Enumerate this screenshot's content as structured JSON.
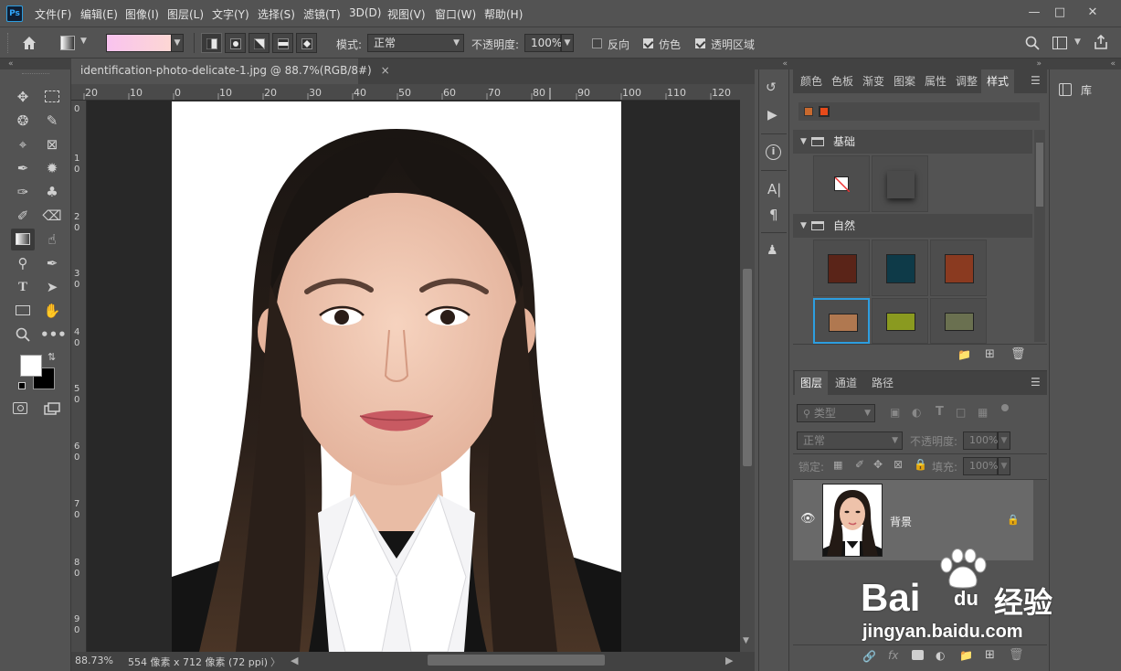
{
  "app": {
    "logo": "Ps"
  },
  "menu": [
    "文件(F)",
    "编辑(E)",
    "图像(I)",
    "图层(L)",
    "文字(Y)",
    "选择(S)",
    "滤镜(T)",
    "3D(D)",
    "视图(V)",
    "窗口(W)",
    "帮助(H)"
  ],
  "options": {
    "mode_label": "模式:",
    "mode_value": "正常",
    "opacity_label": "不透明度:",
    "opacity_value": "100%",
    "reverse_label": "反向",
    "dither_label": "仿色",
    "transparency_label": "透明区域",
    "reverse_checked": false,
    "dither_checked": true,
    "transparency_checked": true
  },
  "document": {
    "tab_title": "identification-photo-delicate-1.jpg @ 88.7%(RGB/8#)",
    "tab_close": "×",
    "ruler_h": [
      "20",
      "10",
      "0",
      "10",
      "20",
      "30",
      "40",
      "50",
      "60",
      "70",
      "80",
      "90",
      "100",
      "110",
      "120"
    ],
    "ruler_v": [
      "0",
      "1",
      "0",
      "2",
      "0",
      "3",
      "0",
      "4",
      "0",
      "5",
      "0",
      "6",
      "0",
      "7",
      "0",
      "8",
      "0",
      "9",
      "0"
    ]
  },
  "status": {
    "zoom": "88.73%",
    "info": "554 像素 x 712 像素 (72 ppi)"
  },
  "styles_panel": {
    "tabs": [
      "颜色",
      "色板",
      "渐变",
      "图案",
      "属性",
      "调整",
      "样式"
    ],
    "active_tab": "样式",
    "groups": [
      {
        "name": "基础"
      },
      {
        "name": "自然"
      }
    ],
    "swatch_colors": [
      "#5a2418",
      "#0e3a48",
      "#8a3a20",
      "#b07850",
      "#8a9a20",
      "#6a7050"
    ]
  },
  "library_panel": {
    "label": "库"
  },
  "layers_panel": {
    "tabs": [
      "图层",
      "通道",
      "路径"
    ],
    "active_tab": "图层",
    "filter_label": "类型",
    "blend_mode": "正常",
    "opacity_label": "不透明度:",
    "opacity_value": "100%",
    "lock_label": "锁定:",
    "fill_label": "填充:",
    "fill_value": "100%",
    "layers": [
      {
        "name": "背景",
        "locked": true,
        "visible": true
      }
    ]
  },
  "watermark": {
    "brand": "Bai",
    "brand2": "du",
    "brand_cn": "经验",
    "url": "jingyan.baidu.com"
  },
  "colors": {
    "ui_bg": "#535353",
    "panel_dark": "#424242",
    "canvas_bg": "#282828",
    "accent_selection": "#2d9ee0",
    "foreground_color": "#ffffff",
    "background_color": "#000000"
  }
}
